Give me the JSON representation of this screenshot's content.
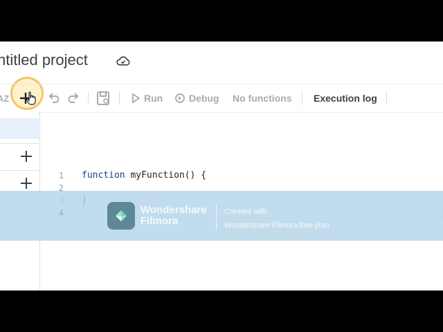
{
  "project": {
    "title": "ntitled project"
  },
  "toolbar": {
    "run_label": "Run",
    "debug_label": "Debug",
    "functions_label": "No functions",
    "execution_log_label": "Execution log"
  },
  "editor": {
    "lines": [
      {
        "num": "1",
        "keyword": "function",
        "rest": " myFunction() {"
      },
      {
        "num": "2",
        "keyword": "",
        "rest": ""
      },
      {
        "num": "3",
        "keyword": "",
        "rest": "}"
      },
      {
        "num": "4",
        "keyword": "",
        "rest": ""
      }
    ]
  },
  "watermark": {
    "brand_line1": "Wondershare",
    "brand_line2": "Filmora",
    "info_line1": "Created with",
    "info_line2": "Wondershare Filmora free plan"
  },
  "icons": {
    "cloud": "cloud-status-icon",
    "sort": "sort-az-icon",
    "add": "add-file-icon",
    "undo": "undo-icon",
    "redo": "redo-icon",
    "save": "save-icon",
    "run": "play-icon",
    "debug": "debug-icon",
    "cursor": "hand-cursor-icon"
  },
  "colors": {
    "highlight": "#f2c56a",
    "selected_file": "#e8f0fe",
    "watermark_bg": "#b0d4e8",
    "code_keyword": "#1f3a8a"
  }
}
